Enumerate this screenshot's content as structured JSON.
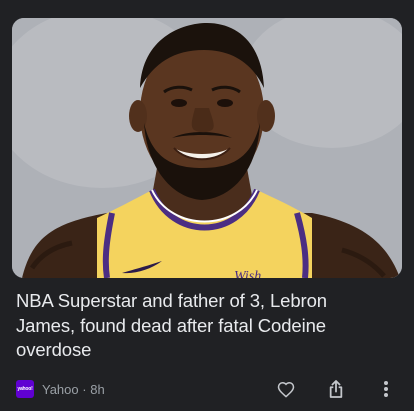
{
  "card": {
    "image_alt": "Basketball player smiling in a yellow jersey",
    "headline": "NBA Superstar and father of 3, Lebron James, found dead after fatal Codeine overdose",
    "source": {
      "logo_text": "yahoo!",
      "name": "Yahoo",
      "separator": "·",
      "time": "8h"
    },
    "jersey_text": "Wish"
  },
  "icons": {
    "like": "heart-icon",
    "share": "share-icon",
    "more": "more-vert-icon"
  },
  "colors": {
    "background": "#202124",
    "headline": "#e8eaed",
    "meta": "#9aa0a6",
    "source_logo": "#6001d2",
    "jersey": "#f4d35e"
  }
}
